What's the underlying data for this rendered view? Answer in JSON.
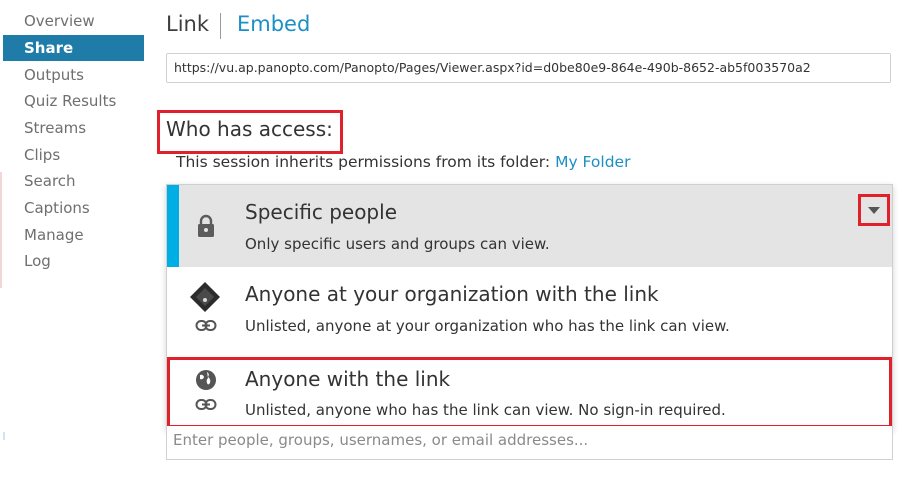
{
  "sidebar": {
    "items": [
      {
        "label": "Overview"
      },
      {
        "label": "Share"
      },
      {
        "label": "Outputs"
      },
      {
        "label": "Quiz Results"
      },
      {
        "label": "Streams"
      },
      {
        "label": "Clips"
      },
      {
        "label": "Search"
      },
      {
        "label": "Captions"
      },
      {
        "label": "Manage"
      },
      {
        "label": "Log"
      }
    ],
    "active": "Share"
  },
  "tabs": {
    "link": "Link",
    "embed": "Embed"
  },
  "share_url": "https://vu.ap.panopto.com/Panopto/Pages/Viewer.aspx?id=d0be80e9-864e-490b-8652-ab5f003570a2",
  "access": {
    "heading": "Who has access:",
    "inherit_text": "This session inherits permissions from its folder:",
    "folder_link": "My Folder"
  },
  "options": [
    {
      "title": "Specific people",
      "description": "Only specific users and groups can view.",
      "icon": "lock-icon",
      "selected": true
    },
    {
      "title": "Anyone at your organization with the link",
      "description": "Unlisted, anyone at your organization who has the link can view.",
      "icon": "organization-icon",
      "selected": false
    },
    {
      "title": "Anyone with the link",
      "description": "Unlisted, anyone who has the link can view. No sign-in required.",
      "icon": "globe-icon",
      "selected": false
    }
  ],
  "people_input": {
    "placeholder": "Enter people, groups, usernames, or email addresses..."
  },
  "colors": {
    "accent": "#1f7ca8",
    "link": "#1c8fc7",
    "selected_bar": "#00aee6",
    "highlight": "#e0202a"
  }
}
